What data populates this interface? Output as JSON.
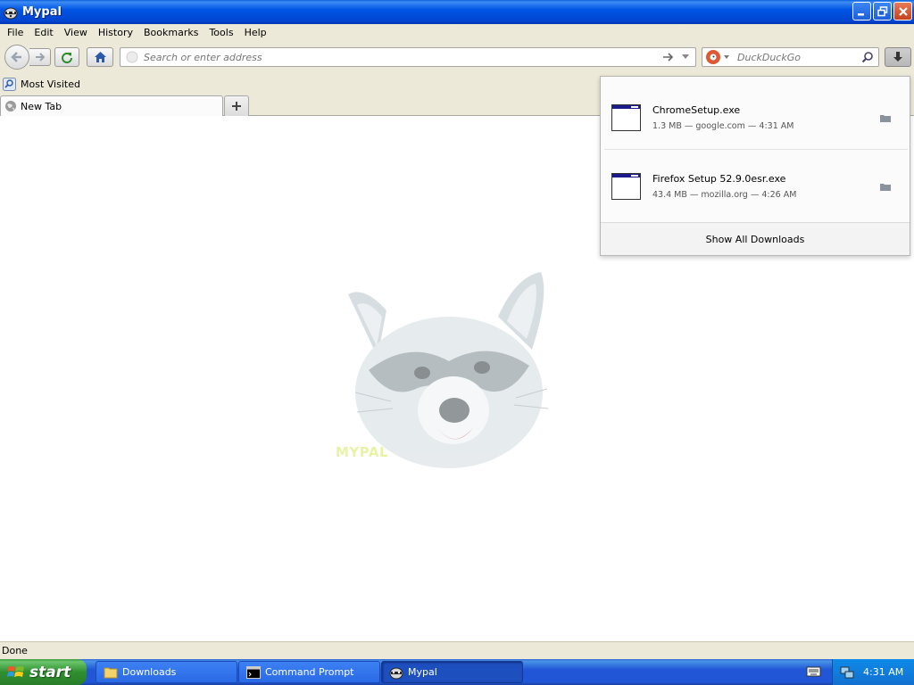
{
  "window": {
    "title": "Mypal"
  },
  "menu": {
    "items": [
      "File",
      "Edit",
      "View",
      "History",
      "Bookmarks",
      "Tools",
      "Help"
    ]
  },
  "navbar": {
    "url_placeholder": "Search or enter address",
    "search_placeholder": "DuckDuckGo"
  },
  "bookmarks": {
    "items": [
      {
        "label": "Most Visited"
      }
    ]
  },
  "tabs": [
    {
      "label": "New Tab"
    }
  ],
  "content": {
    "mascot_text": "MYPAL"
  },
  "status": {
    "text": "Done"
  },
  "downloads": {
    "items": [
      {
        "name": "ChromeSetup.exe",
        "meta": "1.3 MB — google.com — 4:31 AM"
      },
      {
        "name": "Firefox Setup 52.9.0esr.exe",
        "meta": "43.4 MB — mozilla.org — 4:26 AM"
      }
    ],
    "show_all_label": "Show All Downloads"
  },
  "taskbar": {
    "start_label": "start",
    "tasks": [
      {
        "label": "Downloads",
        "icon": "folder-icon"
      },
      {
        "label": "Command Prompt",
        "icon": "cmd-icon"
      },
      {
        "label": "Mypal",
        "icon": "mypal-icon"
      }
    ],
    "clock": "4:31 AM"
  },
  "colors": {
    "titlebar": "#0055e5",
    "taskbar": "#2157d7",
    "start_button": "#2f8f2f",
    "tray": "#0e8ae8",
    "duckduckgo": "#de5833"
  }
}
